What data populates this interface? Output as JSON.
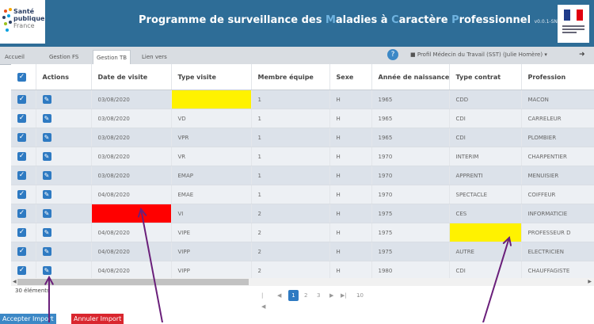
{
  "brand": {
    "line1": "Santé",
    "line2": "publique",
    "line3": "France"
  },
  "title": {
    "seg1": "Programme de surveillance des ",
    "accent1": "M",
    "seg2": "aladies à ",
    "accent2": "C",
    "seg3": "aractère ",
    "accent3": "P",
    "seg4": "rofessionnel",
    "version": "v0.0.1-SNAPSHOT"
  },
  "tabs": [
    "Accueil",
    "Gestion FS",
    "Gestion TB",
    "Lien vers"
  ],
  "help_icon": "?",
  "profile": "Profil Médecin du Travail (SST) (Julie Homère)",
  "columns": [
    "Actions",
    "Date de visite",
    "Type visite",
    "Membre équipe",
    "Sexe",
    "Année de naissance",
    "Type contrat",
    "Profession"
  ],
  "rows": [
    {
      "date": "03/08/2020",
      "type": "",
      "membre": "1",
      "sexe": "H",
      "annee": "1965",
      "contrat": "CDD",
      "profession": "MACON"
    },
    {
      "date": "03/08/2020",
      "type": "VD",
      "membre": "1",
      "sexe": "H",
      "annee": "1965",
      "contrat": "CDI",
      "profession": "CARRELEUR"
    },
    {
      "date": "03/08/2020",
      "type": "VPR",
      "membre": "1",
      "sexe": "H",
      "annee": "1965",
      "contrat": "CDI",
      "profession": "PLOMBIER"
    },
    {
      "date": "03/08/2020",
      "type": "VR",
      "membre": "1",
      "sexe": "H",
      "annee": "1970",
      "contrat": "INTERIM",
      "profession": "CHARPENTIER"
    },
    {
      "date": "03/08/2020",
      "type": "EMAP",
      "membre": "1",
      "sexe": "H",
      "annee": "1970",
      "contrat": "APPRENTI",
      "profession": "MENUISIER"
    },
    {
      "date": "04/08/2020",
      "type": "EMAE",
      "membre": "1",
      "sexe": "H",
      "annee": "1970",
      "contrat": "SPECTACLE",
      "profession": "COIFFEUR"
    },
    {
      "date": "",
      "type": "VI",
      "membre": "2",
      "sexe": "H",
      "annee": "1975",
      "contrat": "CES",
      "profession": "INFORMATICIE"
    },
    {
      "date": "04/08/2020",
      "type": "VIPE",
      "membre": "2",
      "sexe": "H",
      "annee": "1975",
      "contrat": "",
      "profession": "PROFESSEUR D"
    },
    {
      "date": "04/08/2020",
      "type": "VIPP",
      "membre": "2",
      "sexe": "H",
      "annee": "1975",
      "contrat": "AUTRE",
      "profession": "ELECTRICIEN"
    },
    {
      "date": "04/08/2020",
      "type": "VIPP",
      "membre": "2",
      "sexe": "H",
      "annee": "1980",
      "contrat": "CDI",
      "profession": "CHAUFFAGISTE"
    }
  ],
  "highlights": {
    "yellow": "#fff200",
    "red": "#ff0000",
    "arrow": "#6a1f7a",
    "accent": "#2e7ac2"
  },
  "footer": {
    "count": "30 éléments",
    "pages": [
      "1",
      "2",
      "3"
    ],
    "page_size": "10",
    "accept_label": "Accepter Import",
    "cancel_label": "Annuler Import"
  }
}
